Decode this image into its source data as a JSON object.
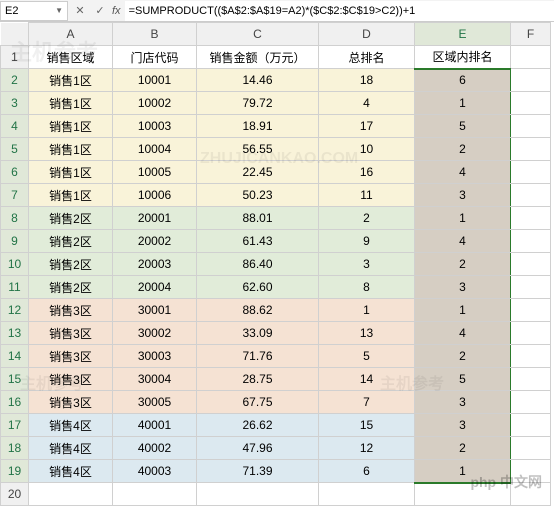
{
  "formula_bar": {
    "cell_ref": "E2",
    "fx": "fx",
    "formula": "=SUMPRODUCT(($A$2:$A$19=A2)*($C$2:$C$19>C2))+1"
  },
  "columns": [
    "A",
    "B",
    "C",
    "D",
    "E",
    "F"
  ],
  "headers": {
    "region": "销售区域",
    "store": "门店代码",
    "amount": "销售金额（万元）",
    "rank_all": "总排名",
    "rank_region": "区域内排名"
  },
  "chart_data": {
    "type": "table",
    "columns": [
      "销售区域",
      "门店代码",
      "销售金额（万元）",
      "总排名",
      "区域内排名"
    ],
    "rows": [
      {
        "group": 1,
        "region": "销售1区",
        "store": "10001",
        "amount": "14.46",
        "rank_all": "18",
        "rank_region": "6"
      },
      {
        "group": 1,
        "region": "销售1区",
        "store": "10002",
        "amount": "79.72",
        "rank_all": "4",
        "rank_region": "1"
      },
      {
        "group": 1,
        "region": "销售1区",
        "store": "10003",
        "amount": "18.91",
        "rank_all": "17",
        "rank_region": "5"
      },
      {
        "group": 1,
        "region": "销售1区",
        "store": "10004",
        "amount": "56.55",
        "rank_all": "10",
        "rank_region": "2"
      },
      {
        "group": 1,
        "region": "销售1区",
        "store": "10005",
        "amount": "22.45",
        "rank_all": "16",
        "rank_region": "4"
      },
      {
        "group": 1,
        "region": "销售1区",
        "store": "10006",
        "amount": "50.23",
        "rank_all": "11",
        "rank_region": "3"
      },
      {
        "group": 2,
        "region": "销售2区",
        "store": "20001",
        "amount": "88.01",
        "rank_all": "2",
        "rank_region": "1"
      },
      {
        "group": 2,
        "region": "销售2区",
        "store": "20002",
        "amount": "61.43",
        "rank_all": "9",
        "rank_region": "4"
      },
      {
        "group": 2,
        "region": "销售2区",
        "store": "20003",
        "amount": "86.40",
        "rank_all": "3",
        "rank_region": "2"
      },
      {
        "group": 2,
        "region": "销售2区",
        "store": "20004",
        "amount": "62.60",
        "rank_all": "8",
        "rank_region": "3"
      },
      {
        "group": 3,
        "region": "销售3区",
        "store": "30001",
        "amount": "88.62",
        "rank_all": "1",
        "rank_region": "1"
      },
      {
        "group": 3,
        "region": "销售3区",
        "store": "30002",
        "amount": "33.09",
        "rank_all": "13",
        "rank_region": "4"
      },
      {
        "group": 3,
        "region": "销售3区",
        "store": "30003",
        "amount": "71.76",
        "rank_all": "5",
        "rank_region": "2"
      },
      {
        "group": 3,
        "region": "销售3区",
        "store": "30004",
        "amount": "28.75",
        "rank_all": "14",
        "rank_region": "5"
      },
      {
        "group": 3,
        "region": "销售3区",
        "store": "30005",
        "amount": "67.75",
        "rank_all": "7",
        "rank_region": "3"
      },
      {
        "group": 4,
        "region": "销售4区",
        "store": "40001",
        "amount": "26.62",
        "rank_all": "15",
        "rank_region": "3"
      },
      {
        "group": 4,
        "region": "销售4区",
        "store": "40002",
        "amount": "47.96",
        "rank_all": "12",
        "rank_region": "2"
      },
      {
        "group": 4,
        "region": "销售4区",
        "store": "40003",
        "amount": "71.39",
        "rank_all": "6",
        "rank_region": "1"
      }
    ]
  },
  "footer_watermark": "php 中文网",
  "bg_watermark": "主机参考"
}
